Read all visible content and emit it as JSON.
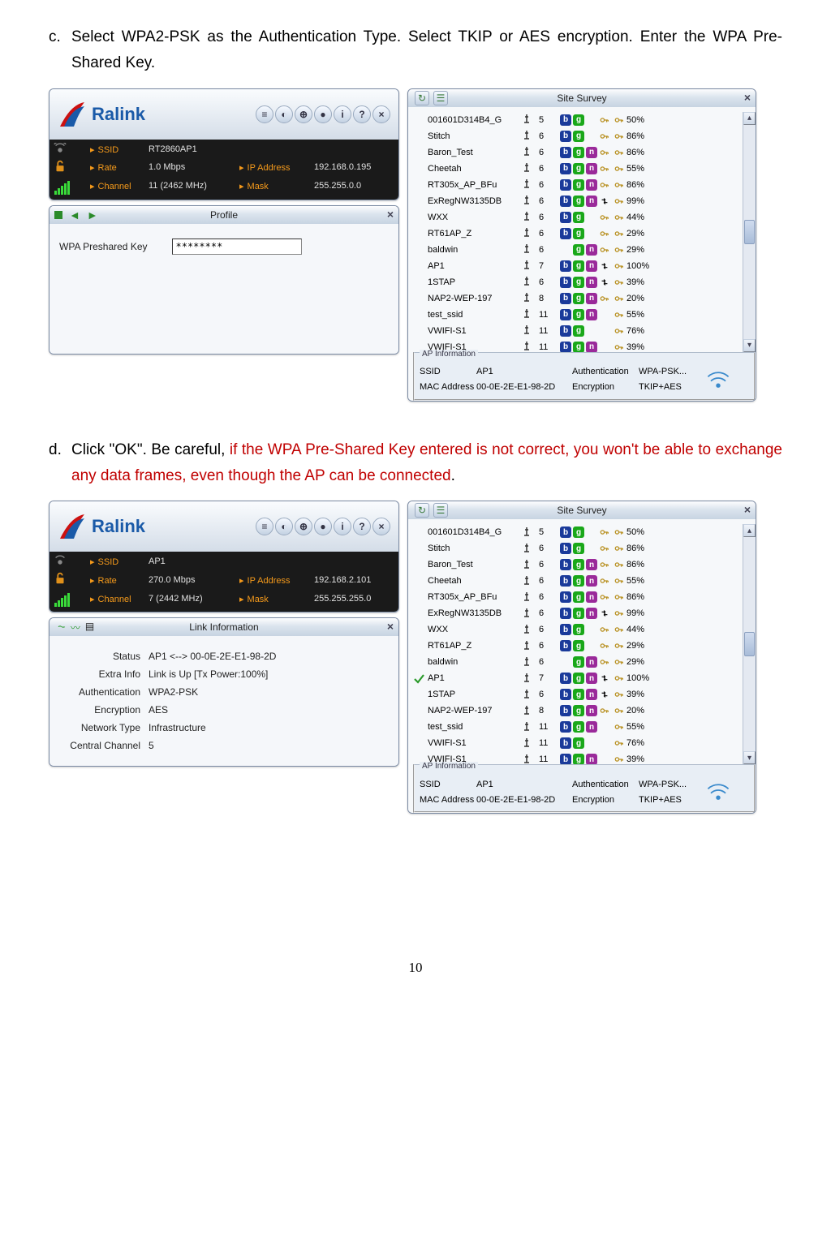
{
  "instructions": {
    "c": {
      "marker": "c.",
      "text": "Select WPA2-PSK as the Authentication Type. Select TKIP or AES encryption. Enter the WPA Pre-Shared Key."
    },
    "d": {
      "marker": "d.",
      "pre": "Click \"OK\". Be careful, ",
      "warn": "if the WPA Pre-Shared Key entered is not correct, you won't be able to exchange any data frames, even though the AP can be connected",
      "post": "."
    }
  },
  "ralink": {
    "brand": "Ralink"
  },
  "status1": {
    "ssid_label": "SSID",
    "ssid": "RT2860AP1",
    "rate_label": "Rate",
    "rate": "1.0 Mbps",
    "channel_label": "Channel",
    "channel": "11 (2462 MHz)",
    "ip_label": "IP Address",
    "ip": "192.168.0.195",
    "mask_label": "Mask",
    "mask": "255.255.0.0"
  },
  "status2": {
    "ssid_label": "SSID",
    "ssid": "AP1",
    "rate_label": "Rate",
    "rate": "270.0 Mbps",
    "channel_label": "Channel",
    "channel": "7 (2442 MHz)",
    "ip_label": "IP Address",
    "ip": "192.168.2.101",
    "mask_label": "Mask",
    "mask": "255.255.255.0"
  },
  "profile": {
    "title": "Profile",
    "psk_label": "WPA Preshared Key",
    "psk_value": "********"
  },
  "linkinfo": {
    "title": "Link Information",
    "rows": {
      "status_k": "Status",
      "status_v": "AP1 <--> 00-0E-2E-E1-98-2D",
      "extra_k": "Extra Info",
      "extra_v": "Link is Up  [Tx Power:100%]",
      "auth_k": "Authentication",
      "auth_v": "WPA2-PSK",
      "enc_k": "Encryption",
      "enc_v": "AES",
      "nt_k": "Network Type",
      "nt_v": "Infrastructure",
      "cc_k": "Central Channel",
      "cc_v": "5"
    }
  },
  "survey": {
    "title": "Site Survey",
    "apinfo_legend": "AP Information",
    "apinfo": {
      "ssid_k": "SSID",
      "ssid_v": "AP1",
      "auth_k": "Authentication",
      "auth_v": "WPA-PSK...",
      "mac_k": "MAC Address",
      "mac_v": "00-0E-2E-E1-98-2D",
      "enc_k": "Encryption",
      "enc_v": "TKIP+AES"
    },
    "rows": [
      {
        "name": "001601D314B4_G",
        "ch": "5",
        "b": 1,
        "g": 1,
        "n": 0,
        "sec": 1,
        "pct": "50%",
        "chk": 0
      },
      {
        "name": "Stitch",
        "ch": "6",
        "b": 1,
        "g": 1,
        "n": 0,
        "sec": 1,
        "pct": "86%",
        "chk": 0
      },
      {
        "name": "Baron_Test",
        "ch": "6",
        "b": 1,
        "g": 1,
        "n": 1,
        "sec": 1,
        "pct": "86%",
        "chk": 0
      },
      {
        "name": "Cheetah",
        "ch": "6",
        "b": 1,
        "g": 1,
        "n": 1,
        "sec": 1,
        "pct": "55%",
        "chk": 0
      },
      {
        "name": "RT305x_AP_BFu",
        "ch": "6",
        "b": 1,
        "g": 1,
        "n": 1,
        "sec": 1,
        "pct": "86%",
        "chk": 0
      },
      {
        "name": "ExRegNW3135DB",
        "ch": "6",
        "b": 1,
        "g": 1,
        "n": 1,
        "sec": 2,
        "pct": "99%",
        "chk": 0
      },
      {
        "name": "WXX",
        "ch": "6",
        "b": 1,
        "g": 1,
        "n": 0,
        "sec": 1,
        "pct": "44%",
        "chk": 0
      },
      {
        "name": "RT61AP_Z",
        "ch": "6",
        "b": 1,
        "g": 1,
        "n": 0,
        "sec": 1,
        "pct": "29%",
        "chk": 0
      },
      {
        "name": "baldwin",
        "ch": "6",
        "b": 0,
        "g": 1,
        "n": 1,
        "sec": 1,
        "pct": "29%",
        "chk": 0
      },
      {
        "name": "AP1",
        "ch": "7",
        "b": 1,
        "g": 1,
        "n": 1,
        "sec": 2,
        "pct": "100%",
        "chk": 1
      },
      {
        "name": "1STAP",
        "ch": "6",
        "b": 1,
        "g": 1,
        "n": 1,
        "sec": 2,
        "pct": "39%",
        "chk": 0
      },
      {
        "name": "NAP2-WEP-197",
        "ch": "8",
        "b": 1,
        "g": 1,
        "n": 1,
        "sec": 1,
        "pct": "20%",
        "chk": 0
      },
      {
        "name": "test_ssid",
        "ch": "11",
        "b": 1,
        "g": 1,
        "n": 1,
        "sec": 0,
        "pct": "55%",
        "chk": 0
      },
      {
        "name": "VWIFI-S1",
        "ch": "11",
        "b": 1,
        "g": 1,
        "n": 0,
        "sec": 0,
        "pct": "76%",
        "chk": 0
      },
      {
        "name": "VWIFI-S1",
        "ch": "11",
        "b": 1,
        "g": 1,
        "n": 1,
        "sec": 0,
        "pct": "39%",
        "chk": 0
      }
    ]
  },
  "page_number": "10"
}
